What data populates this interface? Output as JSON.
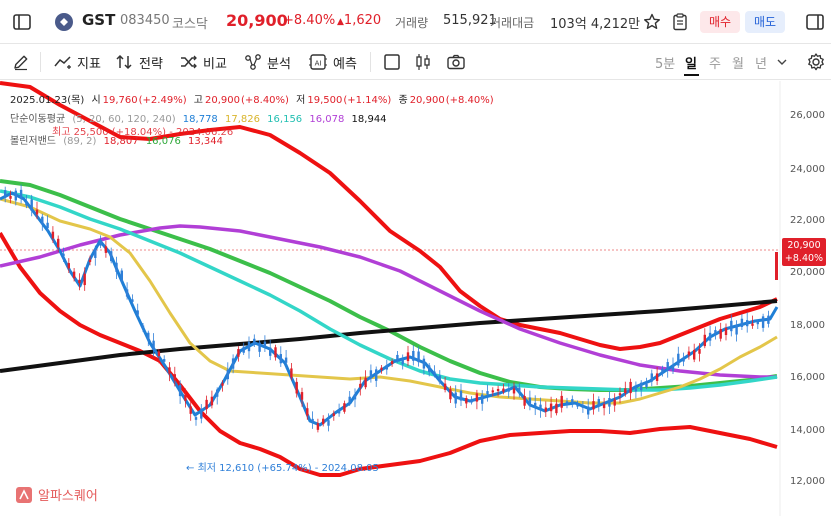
{
  "header": {
    "ticker": "GST",
    "code": "083450",
    "market": "코스닥",
    "price": "20,900",
    "change_pct": "+8.40%",
    "change_abs": "1,620",
    "volume_label": "거래량",
    "volume_value": "515,921",
    "amount_label": "거래대금",
    "amount_value": "103억 4,212만",
    "buy_label": "매수",
    "sell_label": "매도"
  },
  "toolbar": {
    "indicator_label": "지표",
    "strategy_label": "전략",
    "compare_label": "비교",
    "analysis_label": "분석",
    "forecast_label": "예측",
    "timeframes": [
      "5분",
      "일",
      "주",
      "월",
      "년"
    ],
    "active_timeframe": "일"
  },
  "legend": {
    "ohlc": {
      "date": "2025.01.23(목)",
      "open_label": "시",
      "open": "19,760",
      "open_pct": "(+2.49%)",
      "high_label": "고",
      "high": "20,900",
      "high_pct": "(+8.40%)",
      "low_label": "저",
      "low": "19,500",
      "low_pct": "(+1.14%)",
      "close_label": "종",
      "close": "20,900",
      "close_pct": "(+8.40%)"
    },
    "ma": {
      "label": "단순이동평균",
      "params": "(5, 20, 60, 120, 240)",
      "values": [
        "18,778",
        "17,826",
        "16,156",
        "16,078",
        "18,944"
      ]
    },
    "bollinger": {
      "label": "볼린저밴드",
      "params": "(89, 2)",
      "values": [
        "18,807",
        "16,076",
        "13,344"
      ]
    },
    "max_marker": "최고 25,500 (+18.04%) - 2024.06.26"
  },
  "price_axis": [
    "26,000",
    "24,000",
    "22,000",
    "20,000",
    "18,000",
    "16,000",
    "14,000",
    "12,000"
  ],
  "current_tag": {
    "price": "20,900",
    "pct": "+8.40%"
  },
  "min_marker": "최저 12,610 (+65.74%) - 2024.08.05",
  "watermark": "알파스퀘어",
  "colors": {
    "up": "#e0202a",
    "down": "#2f7fd8",
    "ma5": "#1f7fd6",
    "ma20": "#e3c64a",
    "ma60": "#33d6c8",
    "ma120": "#b13fd6",
    "ma240": "#111111",
    "bb_upper": "#ee1111",
    "bb_mid": "#3cbf4a",
    "bb_lower": "#ee1111"
  }
}
